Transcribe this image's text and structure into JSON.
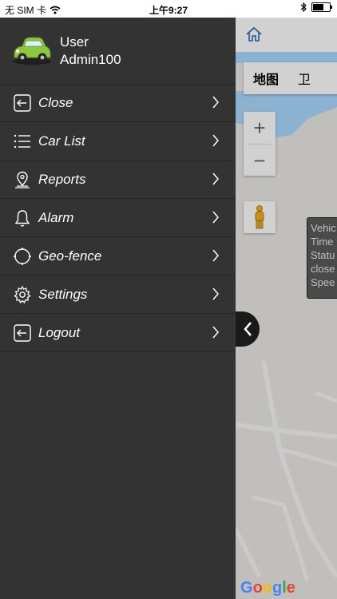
{
  "status_bar": {
    "carrier": "无 SIM 卡",
    "time": "上午9:27",
    "battery_level": 0.72
  },
  "drawer": {
    "user_label": "User",
    "username": "Admin100",
    "avatar_icon": "green-car-icon",
    "items": [
      {
        "label": "Close",
        "icon": "close-arrow-icon"
      },
      {
        "label": "Car List",
        "icon": "list-icon"
      },
      {
        "label": "Reports",
        "icon": "location-pin-icon"
      },
      {
        "label": "Alarm",
        "icon": "bell-icon"
      },
      {
        "label": "Geo-fence",
        "icon": "geofence-icon"
      },
      {
        "label": "Settings",
        "icon": "gear-icon"
      },
      {
        "label": "Logout",
        "icon": "logout-icon"
      }
    ]
  },
  "map": {
    "tabs": [
      "地图",
      "卫"
    ],
    "zoom_in": "+",
    "zoom_out": "−",
    "info_window": [
      "Vehic",
      "Time",
      "Statu",
      "close",
      "Spee"
    ],
    "logo": "Google"
  },
  "colors": {
    "drawer_bg": "#333333",
    "divider": "#262626",
    "map_bg": "#ebe9e5",
    "water": "#aadaff",
    "home_icon": "#2b6fb6"
  }
}
